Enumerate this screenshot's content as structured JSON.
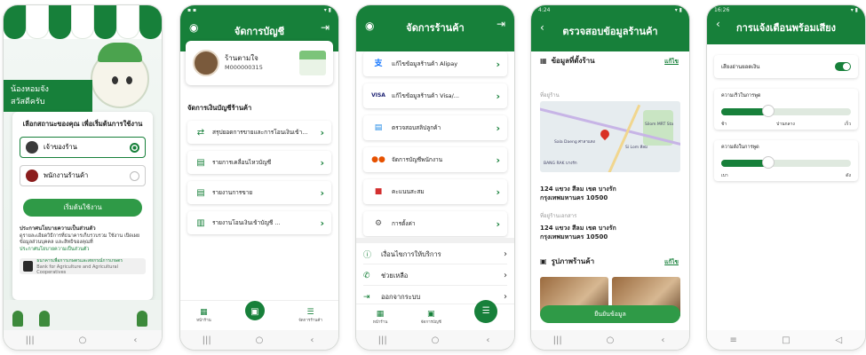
{
  "p1": {
    "banner_l1": "น้องหอมจัง",
    "banner_l2": "สวัสดีครับ",
    "question": "เลือกสถานะของคุณ เพื่อเริ่มต้นการใช้งาน",
    "opt_owner": "เจ้าของร้าน",
    "opt_staff": "พนักงานร้านค้า",
    "start": "เริ่มต้นใช้งาน",
    "pol_title": "ประกาศนโยบายความเป็นส่วนตัว",
    "pol_body": "ดูรายละเอียดวิธีการที่ธนาคารเก็บรวบรวม ใช้งาน เปิดเผยข้อมูลส่วนบุคคล และสิทธิของคุณที่",
    "pol_link": "ประกาศนโยบายความเป็นส่วนตัว",
    "bank_th": "ธนาคารเพื่อการเกษตรและสหกรณ์การเกษตร",
    "bank_en": "Bank for Agriculture and Agricultural Cooperatives"
  },
  "p2": {
    "title": "จัดการบัญชี",
    "shop_name": "ร้านตามใจ",
    "shop_id": "M000000315",
    "section": "จัดการเงินบัญชีร้านค้า",
    "items": [
      "สรุปยอดการขายและการโอนเงินเข้า...",
      "รายการเคลื่อนไหวบัญชี",
      "รายงานการขาย",
      "รายงานโอนเงินเข้าบัญชี ..."
    ],
    "tab1": "หน้าร้าน",
    "tab3": "จัดการร้านค้า"
  },
  "p3": {
    "title": "จัดการร้านค้า",
    "items": [
      "แก้ไขข้อมูลร้านค้า Alipay",
      "แก้ไขข้อมูลร้านค้า Visa/...",
      "ตรวจสอบสลิปลูกค้า",
      "จัดการบัญชีพนักงาน",
      "คะแนนสะสม",
      "การตั้งค่า"
    ],
    "alipay_icon": "支",
    "visa": "VISA",
    "links": [
      "เงื่อนไขการให้บริการ",
      "ช่วยเหลือ",
      "ออกจากระบบ"
    ],
    "tab1": "หน้าร้าน",
    "tab2": "จัดการบัญชี"
  },
  "p4": {
    "status_time": "4:24",
    "title": "ตรวจสอบข้อมูลร้านค้า",
    "sec1": "ข้อมูลที่ตั้งร้าน",
    "edit": "แก้ไข",
    "loc_label": "ที่อยู่ร้าน",
    "map_sala": "Sala Daeng ศาลาแดง",
    "map_silom": "Si Lom สีลม",
    "map_mrt": "Silom MRT Sta",
    "map_bangrak": "BANG RAK บางรัก",
    "addr1_l1": "124 แขวง สีลม เขต บางรัก",
    "addr1_l2": "กรุงเทพมหานคร 10500",
    "doc_label": "ที่อยู่ร้านเอกสาร",
    "addr2_l1": "124 แขวง สีลม เขต บางรัก",
    "addr2_l2": "กรุงเทพมหานคร 10500",
    "sec2": "รูปภาพร้านค้า",
    "confirm": "ยืนยันข้อมูล"
  },
  "p5": {
    "status_time": "16:26",
    "title": "การแจ้งเตือนพร้อมเสียง",
    "toggle_label": "เสียงอ่านยอดเงิน",
    "speed_label": "ความเร็วในการพูด",
    "speed_ticks": [
      "ช้า",
      "ปานกลาง",
      "เร็ว"
    ],
    "volume_label": "ความดังในการพูด",
    "volume_ticks": [
      "เบา",
      "ดัง"
    ],
    "speed_value": 0.36,
    "volume_value": 0.36
  },
  "colors": {
    "brand": "#17803a"
  }
}
